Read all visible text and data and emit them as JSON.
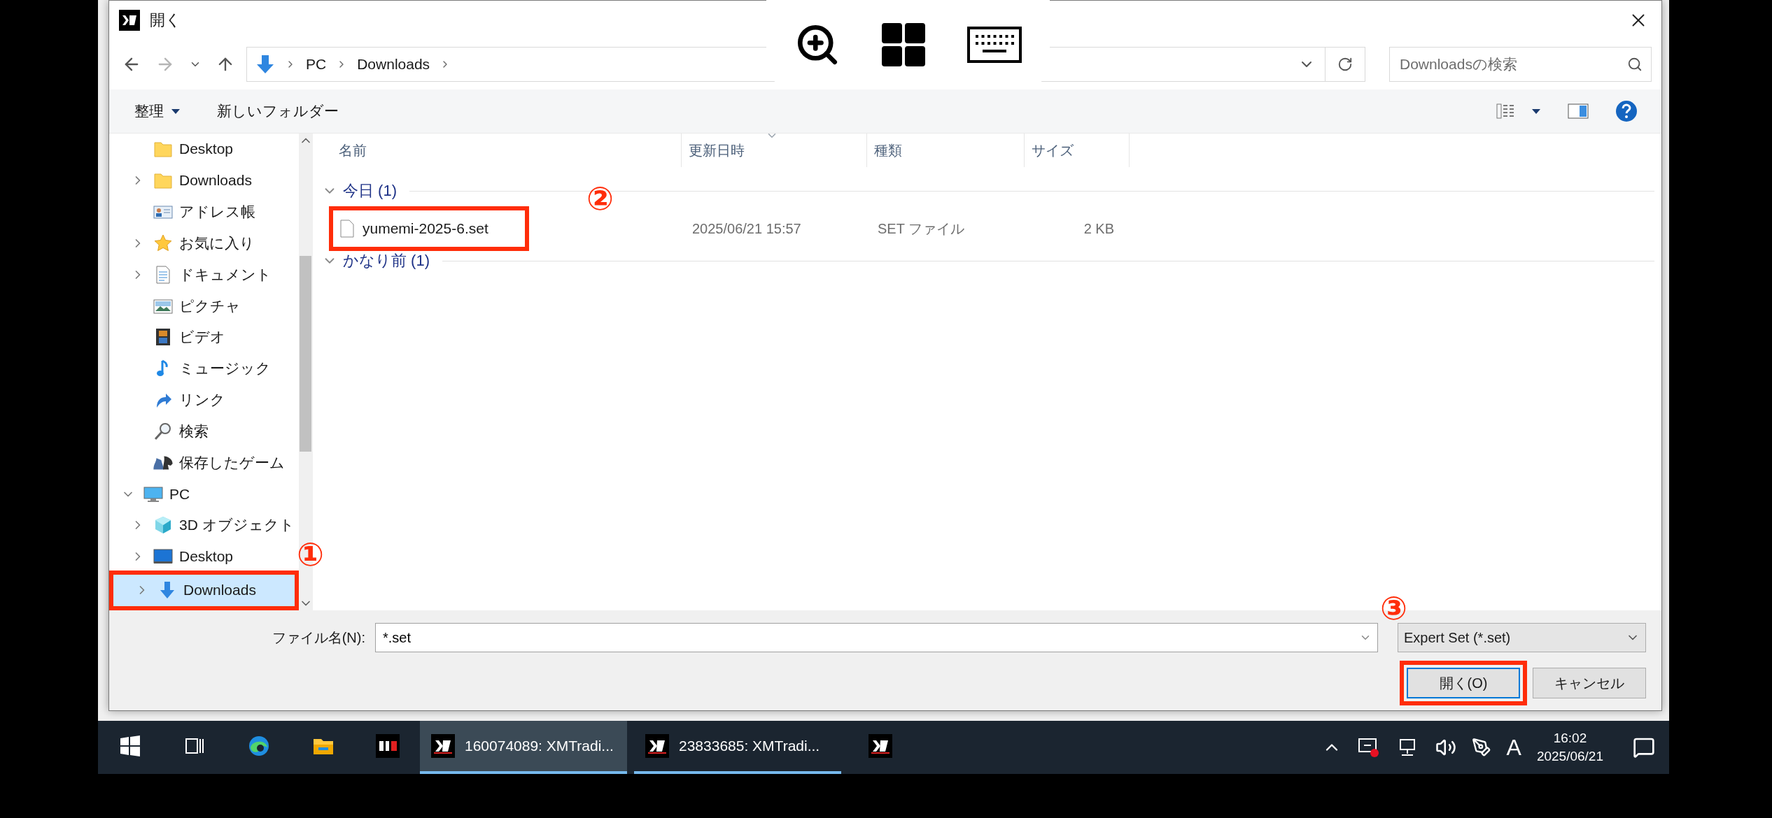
{
  "window": {
    "title": "開く"
  },
  "address_bar": {
    "path": [
      "PC",
      "Downloads"
    ]
  },
  "search": {
    "placeholder": "Downloadsの検索"
  },
  "command_bar": {
    "organize": "整理",
    "new_folder": "新しいフォルダー"
  },
  "nav": [
    {
      "label": "Desktop",
      "kind": "folder",
      "expandable": false,
      "selected": false
    },
    {
      "label": "Downloads",
      "kind": "folder",
      "expandable": true,
      "selected": false
    },
    {
      "label": "アドレス帳",
      "kind": "contacts",
      "expandable": false,
      "selected": false
    },
    {
      "label": "お気に入り",
      "kind": "star",
      "expandable": true,
      "selected": false
    },
    {
      "label": "ドキュメント",
      "kind": "document",
      "expandable": true,
      "selected": false
    },
    {
      "label": "ピクチャ",
      "kind": "picture",
      "expandable": false,
      "selected": false
    },
    {
      "label": "ビデオ",
      "kind": "video",
      "expandable": false,
      "selected": false
    },
    {
      "label": "ミュージック",
      "kind": "music",
      "expandable": false,
      "selected": false
    },
    {
      "label": "リンク",
      "kind": "link",
      "expandable": false,
      "selected": false
    },
    {
      "label": "検索",
      "kind": "search",
      "expandable": false,
      "selected": false
    },
    {
      "label": "保存したゲーム",
      "kind": "games",
      "expandable": false,
      "selected": false
    },
    {
      "label": "PC",
      "kind": "pc",
      "expandable": true,
      "expanded": true,
      "selected": false,
      "children": [
        {
          "label": "3D オブジェクト",
          "kind": "cube",
          "expandable": true,
          "selected": false
        },
        {
          "label": "Desktop",
          "kind": "desktop",
          "expandable": true,
          "selected": false
        },
        {
          "label": "Downloads",
          "kind": "download",
          "expandable": true,
          "selected": true,
          "annotation": "①"
        }
      ]
    }
  ],
  "columns": [
    {
      "label": "名前",
      "sorted": false
    },
    {
      "label": "更新日時",
      "sorted": true
    },
    {
      "label": "種類",
      "sorted": false
    },
    {
      "label": "サイズ",
      "sorted": false
    }
  ],
  "groups": [
    {
      "label": "今日 (1)",
      "expanded": true,
      "files": [
        {
          "name": "yumemi-2025-6.set",
          "modified": "2025/06/21 15:57",
          "type": "SET ファイル",
          "size": "2 KB",
          "annotation": "②"
        }
      ]
    },
    {
      "label": "かなり前 (1)",
      "expanded": true
    }
  ],
  "filename": {
    "label": "ファイル名(N):",
    "value": "*.set"
  },
  "filetype": {
    "value": "Expert Set (*.set)"
  },
  "buttons": [
    {
      "label": "開く(O)",
      "default": true,
      "annotation": "③"
    },
    {
      "label": "キャンセル",
      "default": false
    }
  ],
  "taskbar": {
    "apps": [
      {
        "kind": "start"
      },
      {
        "kind": "taskview"
      },
      {
        "kind": "edge"
      },
      {
        "kind": "explorer"
      },
      {
        "kind": "hfm"
      },
      {
        "kind": "xm",
        "label": "160074089: XMTradi...",
        "active": true,
        "running": true
      },
      {
        "kind": "xm",
        "label": "23833685: XMTradi...",
        "active": false,
        "running": true
      },
      {
        "kind": "xm",
        "active": false,
        "running": false
      }
    ],
    "ime": "A",
    "time": "16:02",
    "date": "2025/06/21"
  }
}
